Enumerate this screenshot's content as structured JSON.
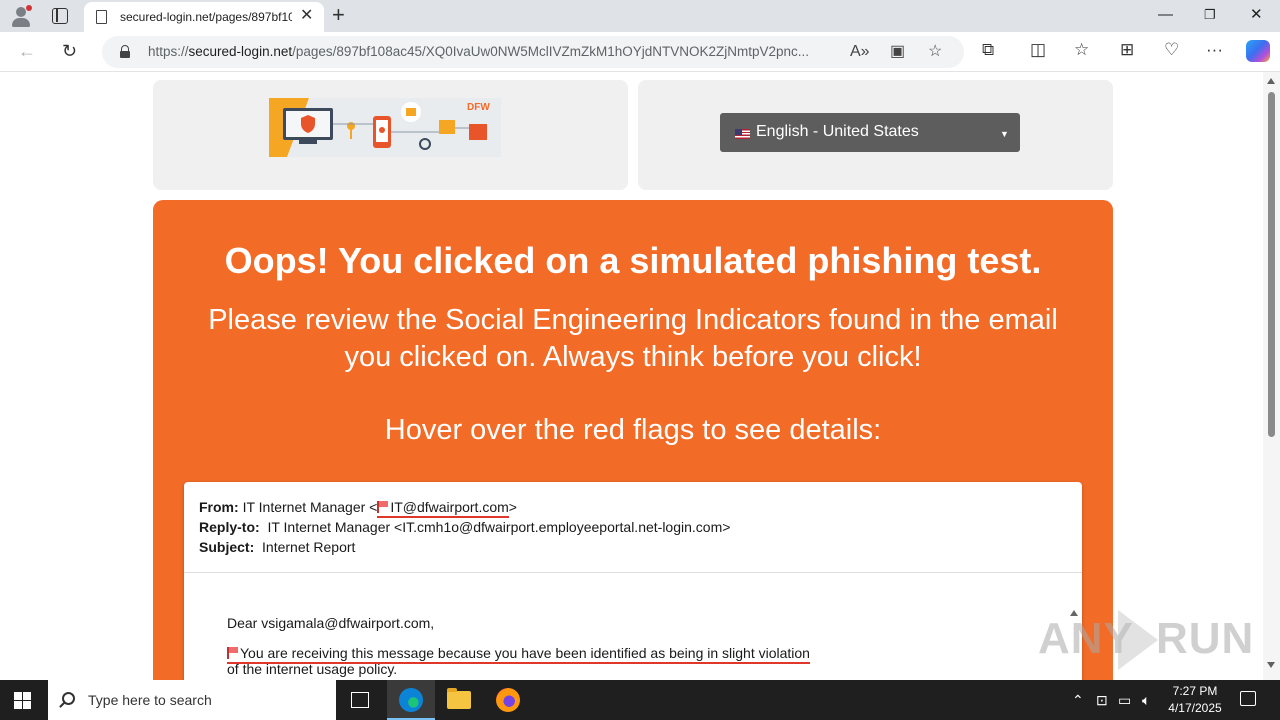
{
  "browser": {
    "tab_title": "secured-login.net/pages/897bf108ac45/XQ0IvaUw0NW5",
    "url_scheme": "https://",
    "url_host": "secured-login.net",
    "url_path": "/pages/897bf108ac45/XQ0IvaUw0NW5MclIVZmZkM1hOYjdNTVNOK2ZjNmtpV2pnc..."
  },
  "page": {
    "logo_text": "DFW",
    "language_selected": "English - United States",
    "heading": "Oops! You clicked on a simulated phishing test.",
    "subheading": "Please review the Social Engineering Indicators found in the email you clicked on. Always think before you click!",
    "instruction": "Hover over the red flags to see details:"
  },
  "email": {
    "from_label": "From:",
    "from_name": "IT Internet Manager <",
    "from_address": "IT@dfwairport.com",
    "from_close": ">",
    "replyto_label": "Reply-to:",
    "replyto_value": "IT Internet Manager <IT.cmh1o@dfwairport.employeeportal.net-login.com>",
    "subject_label": "Subject:",
    "subject_value": "Internet Report",
    "greeting": "Dear vsigamala@dfwairport.com,",
    "body_line1": "You are receiving this message because you have been identified as being in slight violation",
    "body_line2": "of the internet usage policy."
  },
  "watermark": {
    "left": "ANY",
    "right": "RUN"
  },
  "taskbar": {
    "search_placeholder": "Type here to search",
    "time": "7:27 PM",
    "date": "4/17/2025"
  },
  "colors": {
    "banner": "#f26b27",
    "flag": "#e0362c",
    "lang_select": "#5d5d5d"
  }
}
